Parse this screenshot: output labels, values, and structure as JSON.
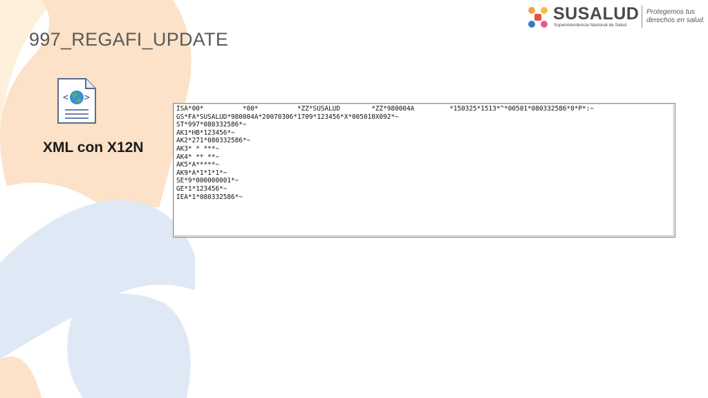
{
  "slide": {
    "title": "997_REGAFI_UPDATE",
    "file_label": "XML con X12N",
    "file_icon": "xml-document-globe-icon"
  },
  "brand": {
    "name": "SUSALUD",
    "subtitle": "Superintendencia Nacional de Salud",
    "tagline_line1": "Protegemos tus",
    "tagline_line2": "derechos en salud.",
    "colors": [
      "#f4a04a",
      "#e8543e",
      "#2f7fc4",
      "#e85a8e",
      "#f3c23a"
    ]
  },
  "editor": {
    "lines": [
      "ISA*00*          *00*          *ZZ*SUSALUD        *ZZ*980004A         *150325*1513*^*00501*080332586*0*P*:~",
      "GS*FA*SUSALUD*980004A*20070306*1709*123456*X*005010X092*~",
      "ST*997*080332586*~",
      "AK1*HB*123456*~",
      "AK2*271*080332586*~",
      "AK3* * ***~",
      "AK4* ** **~",
      "AK5*A*****~",
      "AK9*A*1*1*1*~",
      "SE*9*000000001*~",
      "GE*1*123456*~",
      "IEA*1*080332586*~"
    ]
  },
  "background": {
    "colors": {
      "peach": "#fbe2c8",
      "cream": "#fdf1dc",
      "blue": "#dfe9f6"
    }
  }
}
